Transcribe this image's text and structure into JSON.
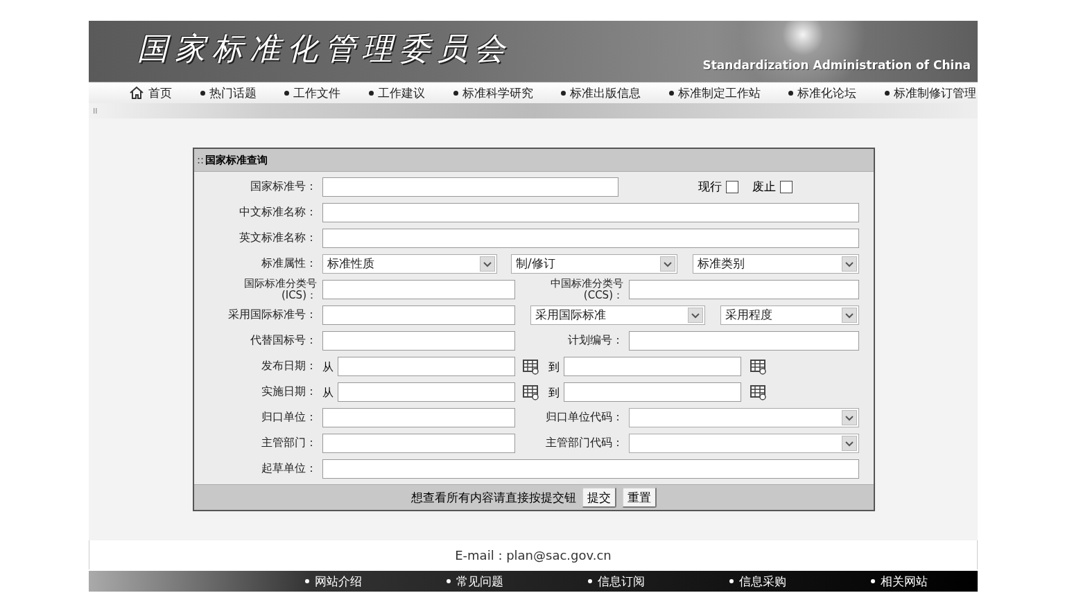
{
  "header": {
    "title_cn": "国家标准化管理委员会",
    "title_en": "Standardization Administration of China"
  },
  "nav": [
    {
      "label": "首页",
      "kind": "home"
    },
    {
      "label": "热门话题",
      "kind": "link"
    },
    {
      "label": "工作文件",
      "kind": "link"
    },
    {
      "label": "工作建议",
      "kind": "link"
    },
    {
      "label": "标准科学研究",
      "kind": "link"
    },
    {
      "label": "标准出版信息",
      "kind": "link"
    },
    {
      "label": "标准制定工作站",
      "kind": "link"
    },
    {
      "label": "标准化论坛",
      "kind": "link"
    },
    {
      "label": "标准制修订管理",
      "kind": "link"
    }
  ],
  "strip_mark": "II",
  "form": {
    "title_prefix": "::",
    "title": "国家标准查询",
    "rows": [
      {
        "kind": "status",
        "label": "国家标准号：",
        "checkboxes": [
          {
            "label": "现行",
            "checked": false
          },
          {
            "label": "废止",
            "checked": false
          }
        ]
      },
      {
        "kind": "wide",
        "label": "中文标准名称："
      },
      {
        "kind": "wide",
        "label": "英文标准名称："
      },
      {
        "kind": "selects",
        "label": "标准属性：",
        "selects": [
          "标准性质",
          "制/修订",
          "标准类别"
        ]
      },
      {
        "kind": "pair",
        "label": "国际标准分类号",
        "label_sub": "(ICS)：",
        "right": {
          "kind": "input",
          "label": "中国标准分类号",
          "label_sub": "(CCS)："
        }
      },
      {
        "kind": "adopt",
        "label": "采用国际标准号：",
        "selects": [
          "采用国际标准",
          "采用程度"
        ]
      },
      {
        "kind": "pair",
        "label": "代替国标号：",
        "right": {
          "kind": "input",
          "label": "计划编号："
        }
      },
      {
        "kind": "date",
        "label": "发布日期：",
        "from": "从",
        "to": "到"
      },
      {
        "kind": "date",
        "label": "实施日期：",
        "from": "从",
        "to": "到"
      },
      {
        "kind": "pair",
        "label": "归口单位：",
        "right": {
          "kind": "select",
          "label": "归口单位代码："
        }
      },
      {
        "kind": "pair",
        "label": "主管部门：",
        "right": {
          "kind": "select",
          "label": "主管部门代码："
        }
      },
      {
        "kind": "wide",
        "label": "起草单位："
      }
    ],
    "hint": "想查看所有内容请直接按提交钮",
    "buttons": [
      "提交",
      "重置"
    ]
  },
  "email": "E-mail : plan@sac.gov.cn",
  "footer_links": [
    "网站介绍",
    "常见问题",
    "信息订阅",
    "信息采购",
    "相关网站"
  ]
}
